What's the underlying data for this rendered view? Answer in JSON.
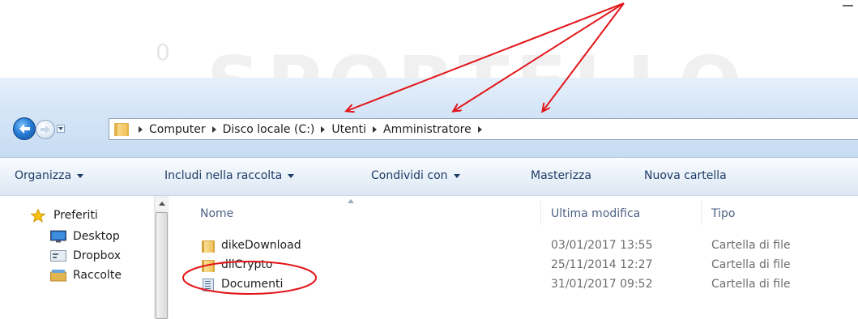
{
  "background_watermark": {
    "text": "SPORTELLO",
    "zero": "0"
  },
  "nav_buttons": {
    "back_icon": "back-arrow-icon",
    "forward_icon": "forward-arrow-icon",
    "recent_icon": "chevron-down-icon"
  },
  "address_bar": {
    "folder_icon": "folder-icon",
    "crumbs": [
      "Computer",
      "Disco locale (C:)",
      "Utenti",
      "Amministratore"
    ]
  },
  "toolbar": {
    "organize": "Organizza",
    "include": "Includi nella raccolta",
    "share": "Condividi con",
    "burn": "Masterizza",
    "new_folder": "Nuova cartella"
  },
  "nav_pane": {
    "items": [
      {
        "label": "Preferiti",
        "icon": "star-icon"
      },
      {
        "label": "Desktop",
        "icon": "desktop-icon"
      },
      {
        "label": "Dropbox",
        "icon": "dropbox-icon"
      },
      {
        "label": "Raccolte",
        "icon": "library-icon"
      }
    ]
  },
  "file_list": {
    "columns": {
      "name": "Nome",
      "modified": "Ultima modifica",
      "type": "Tipo"
    },
    "rows": [
      {
        "name": "dikeDownload",
        "modified": "03/01/2017 13:55",
        "type": "Cartella di file",
        "icon": "folder-icon"
      },
      {
        "name": "dllCrypto",
        "modified": "25/11/2014 12:27",
        "type": "Cartella di file",
        "icon": "folder-icon"
      },
      {
        "name": "Documenti",
        "modified": "31/01/2017 09:52",
        "type": "Cartella di file",
        "icon": "documents-folder-icon"
      }
    ]
  },
  "annotation": {
    "color": "#e3151a"
  },
  "colors": {
    "chrome": "#d4e5f7",
    "toolbar_text": "#1e3d66",
    "header_text": "#4d6185",
    "secondary_text": "#6d6d6d"
  }
}
